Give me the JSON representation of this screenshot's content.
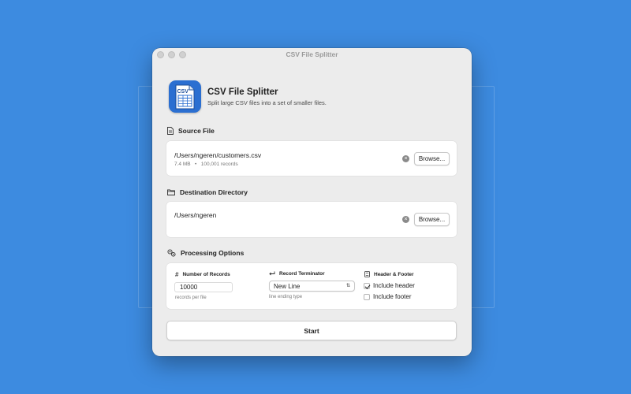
{
  "window": {
    "title": "CSV File Splitter"
  },
  "app": {
    "title": "CSV File Splitter",
    "subtitle": "Split large CSV files into a set of smaller files.",
    "icon_text": "CSV",
    "icon_color": "#2b6fd1"
  },
  "source": {
    "heading": "Source File",
    "path": "/Users/ngeren/customers.csv",
    "size": "7.4 MB",
    "separator": "•",
    "records": "100,001 records",
    "browse_label": "Browse...",
    "clear_icon": "xmark-circle-icon"
  },
  "destination": {
    "heading": "Destination Directory",
    "path": "/Users/ngeren",
    "browse_label": "Browse...",
    "clear_icon": "xmark-circle-icon"
  },
  "options": {
    "heading": "Processing Options",
    "number_of_records": {
      "label": "Number of Records",
      "icon": "#",
      "value": "10000",
      "hint": "records per file"
    },
    "record_terminator": {
      "label": "Record Terminator",
      "icon": "return-arrow-icon",
      "selected": "New Line",
      "hint": "line ending type"
    },
    "header_footer": {
      "label": "Header & Footer",
      "include_header": {
        "label": "Include header",
        "checked": true
      },
      "include_footer": {
        "label": "Include footer",
        "checked": false
      }
    }
  },
  "start_label": "Start",
  "colors": {
    "desktop": "#3d8be0",
    "window": "#ececec",
    "card": "#ffffff"
  }
}
